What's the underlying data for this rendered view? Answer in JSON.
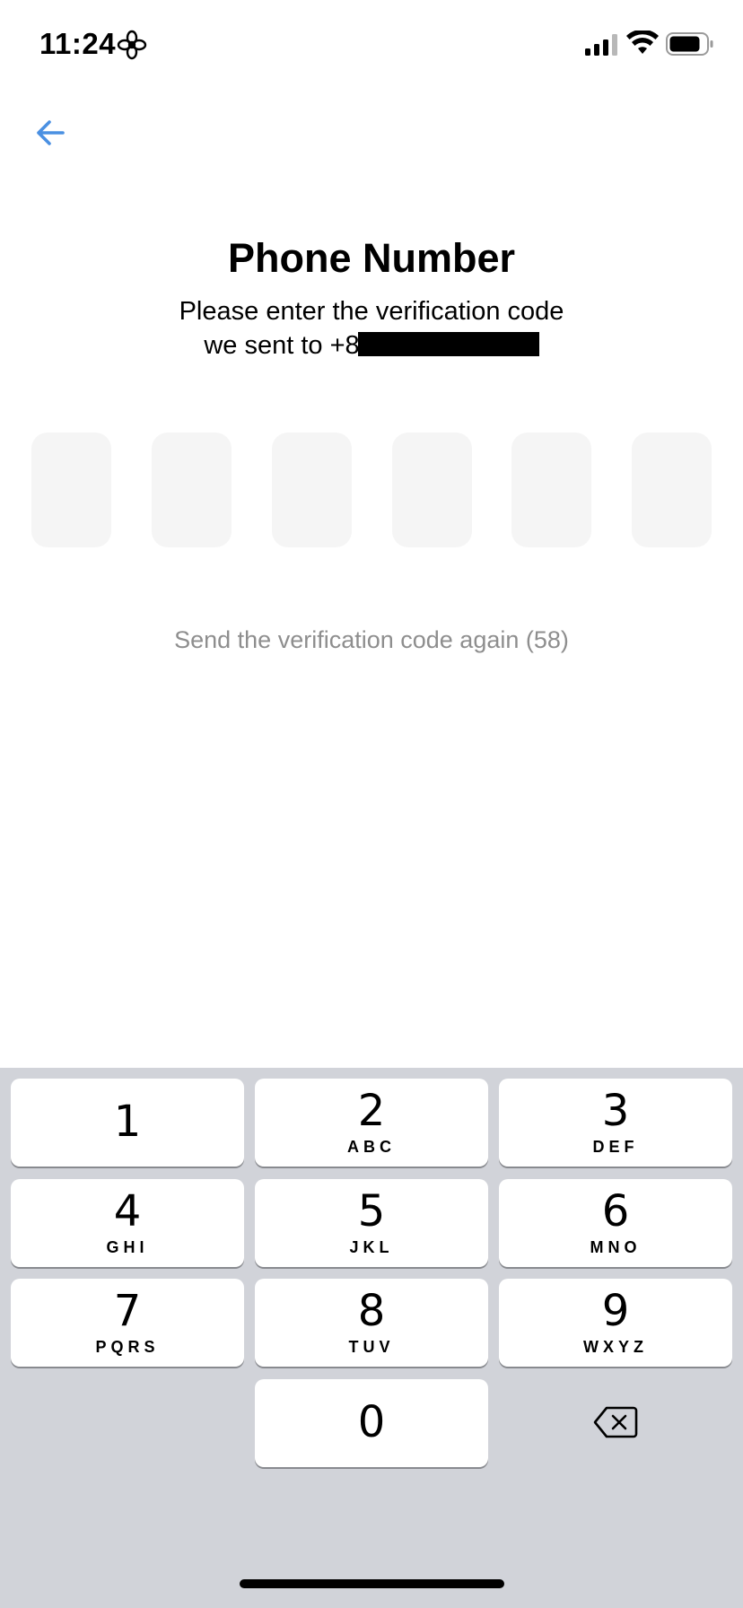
{
  "status_bar": {
    "time": "11:24",
    "icons": [
      "focus-flower-icon",
      "cellular-signal-icon",
      "wifi-icon",
      "battery-icon"
    ]
  },
  "header": {
    "back_icon": "arrow-left-icon",
    "title": "Phone Number",
    "subtitle_line1": "Please enter the verification code",
    "subtitle_line2_prefix": "we sent to +8"
  },
  "code_input": {
    "length": 6,
    "values": [
      "",
      "",
      "",
      "",
      "",
      ""
    ]
  },
  "resend": {
    "label": "Send the verification code again (58)"
  },
  "keyboard": {
    "keys": [
      {
        "digit": "1",
        "letters": ""
      },
      {
        "digit": "2",
        "letters": "ABC"
      },
      {
        "digit": "3",
        "letters": "DEF"
      },
      {
        "digit": "4",
        "letters": "GHI"
      },
      {
        "digit": "5",
        "letters": "JKL"
      },
      {
        "digit": "6",
        "letters": "MNO"
      },
      {
        "digit": "7",
        "letters": "PQRS"
      },
      {
        "digit": "8",
        "letters": "TUV"
      },
      {
        "digit": "9",
        "letters": "WXYZ"
      },
      {
        "digit": "0",
        "letters": ""
      }
    ],
    "delete_icon": "backspace-icon"
  },
  "colors": {
    "accent": "#4a90e2",
    "code_box_bg": "#f5f5f5",
    "muted_text": "#8e8e8e",
    "keyboard_bg": "#d1d3d9"
  }
}
